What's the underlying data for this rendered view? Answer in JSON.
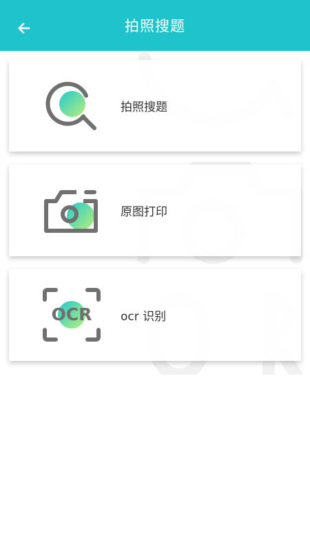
{
  "header": {
    "title": "拍照搜题",
    "back_icon": "arrow-left-icon",
    "background": "#1fc3cc"
  },
  "menu": [
    {
      "label": "拍照搜题",
      "icon": "search-magnifier-icon"
    },
    {
      "label": "原图打印",
      "icon": "camera-icon"
    },
    {
      "label": "ocr 识别",
      "icon": "ocr-scan-icon",
      "icon_text": "OCR"
    }
  ],
  "colors": {
    "gradient_start": "#22c9cf",
    "gradient_end": "#b8f07a",
    "icon_stroke": "#707070",
    "text": "#333333"
  }
}
